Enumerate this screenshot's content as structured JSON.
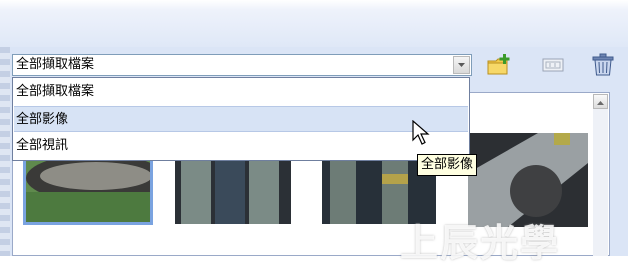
{
  "filter": {
    "selected": "全部擷取檔案",
    "options": [
      "全部擷取檔案",
      "全部影像",
      "全部視訊"
    ],
    "highlighted_index": 1
  },
  "toolbar": {
    "icons": [
      "new-folder-icon",
      "rename-icon",
      "trash-icon"
    ]
  },
  "tooltip": "全部影像",
  "watermark": "上辰光學",
  "colors": {
    "panel": "#dbe5f6",
    "selection": "#d7e3f5",
    "thumb_selected_border": "#7aa3e0",
    "tooltip_bg": "#ffffe1"
  }
}
